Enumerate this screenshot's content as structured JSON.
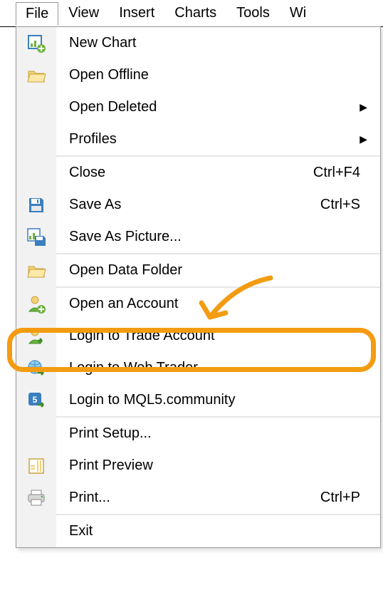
{
  "menubar": {
    "items": [
      "File",
      "View",
      "Insert",
      "Charts",
      "Tools",
      "Wi"
    ]
  },
  "menu": {
    "new_chart": "New Chart",
    "open_offline": "Open Offline",
    "open_deleted": "Open Deleted",
    "profiles": "Profiles",
    "close": "Close",
    "close_shortcut": "Ctrl+F4",
    "save_as": "Save As",
    "save_as_shortcut": "Ctrl+S",
    "save_as_picture": "Save As Picture...",
    "open_data_folder": "Open Data Folder",
    "open_account": "Open an Account",
    "login_trade": "Login to Trade Account",
    "login_web": "Login to Web Trader",
    "login_mql5": "Login to MQL5.community",
    "print_setup": "Print Setup...",
    "print_preview": "Print Preview",
    "print": "Print...",
    "print_shortcut": "Ctrl+P",
    "exit": "Exit"
  },
  "annotation": {
    "highlighted_item": "login_trade",
    "color": "#f39c12"
  }
}
